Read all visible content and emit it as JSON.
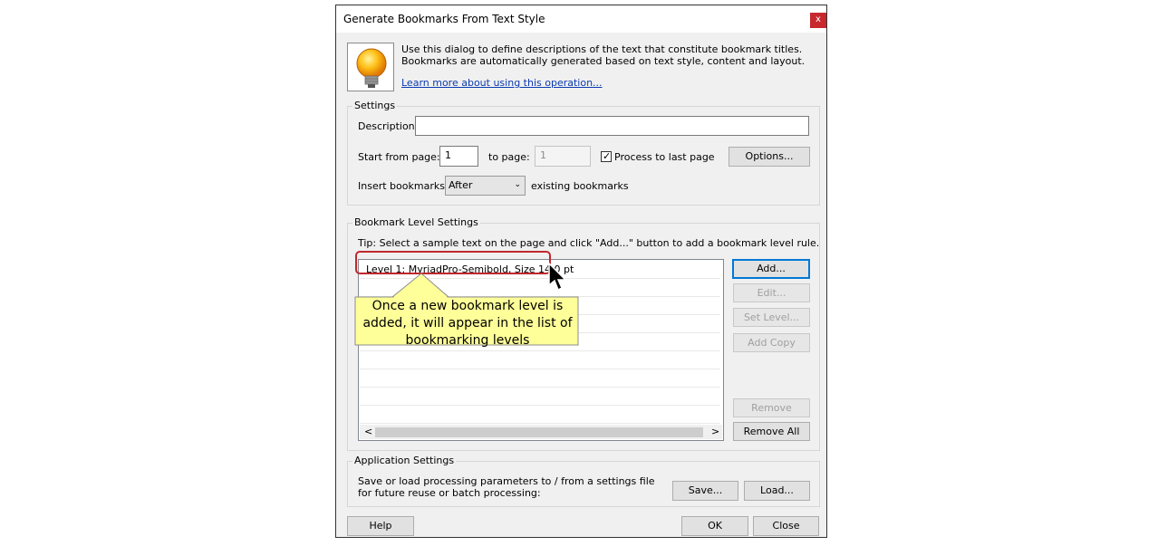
{
  "dialog": {
    "title": "Generate Bookmarks From Text Style",
    "close_glyph": "x",
    "intro": "Use this dialog to define descriptions of the text that constitute bookmark titles. Bookmarks are automatically generated based on text style, content and layout.",
    "link": "Learn more about using this operation..."
  },
  "settings": {
    "group_title": "Settings",
    "description_label": "Description:",
    "description_value": "",
    "start_label": "Start from page:",
    "start_value": "1",
    "to_label": "to page:",
    "to_value": "1",
    "process_label": "Process to last page",
    "process_checked": true,
    "options_label": "Options...",
    "insert_label": "Insert bookmarks:",
    "insert_value": "After",
    "insert_suffix": "existing bookmarks"
  },
  "levels": {
    "group_title": "Bookmark Level Settings",
    "tip": "Tip: Select a sample text on the page and click \"Add...\" button to add a bookmark level rule.",
    "items": [
      "Level 1: MyriadPro-Semibold, Size 14.0 pt"
    ],
    "buttons": {
      "add": "Add...",
      "edit": "Edit...",
      "set_level": "Set Level...",
      "add_copy": "Add Copy",
      "remove": "Remove",
      "remove_all": "Remove All"
    },
    "scroll_left": "<",
    "scroll_right": ">"
  },
  "callout": {
    "text": "Once a new bookmark level is added, it will appear in the list of bookmarking levels",
    "color": "#ffff99",
    "highlight_color": "#c0282e"
  },
  "app_settings": {
    "group_title": "Application Settings",
    "text": "Save or load processing parameters to / from a settings file for future reuse or batch processing:",
    "save": "Save...",
    "load": "Load..."
  },
  "footer": {
    "help": "Help",
    "ok": "OK",
    "close": "Close"
  },
  "icons": [
    "lightbulb-icon",
    "mouse-pointer-icon",
    "checkmark-icon",
    "chevron-down-icon"
  ]
}
